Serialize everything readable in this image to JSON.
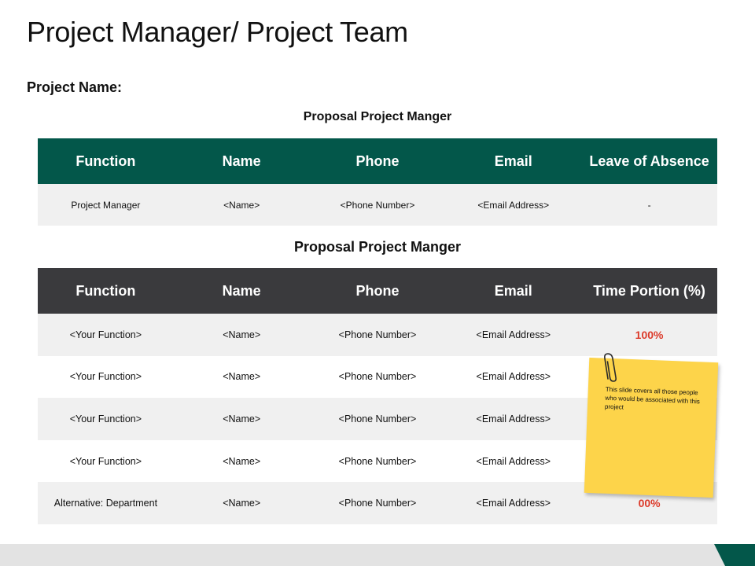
{
  "slide": {
    "title": "Project Manager/ Project Team",
    "project_name_label": "Project Name:"
  },
  "section1": {
    "title": "Proposal Project Manger",
    "headers": [
      "Function",
      "Name",
      "Phone",
      "Email",
      "Leave of Absence"
    ],
    "rows": [
      [
        "Project Manager",
        "<Name>",
        "<Phone Number>",
        "<Email Address>",
        "-"
      ]
    ]
  },
  "section2": {
    "title": "Proposal Project Manger",
    "headers": [
      "Function",
      "Name",
      "Phone",
      "Email",
      "Time Portion (%)"
    ],
    "rows": [
      [
        "<Your Function>",
        "<Name>",
        "<Phone Number>",
        "<Email Address>",
        "100%"
      ],
      [
        "<Your Function>",
        "<Name>",
        "<Phone Number>",
        "<Email Address>",
        ""
      ],
      [
        "<Your Function>",
        "<Name>",
        "<Phone Number>",
        "<Email Address>",
        ""
      ],
      [
        "<Your Function>",
        "<Name>",
        "<Phone Number>",
        "<Email Address>",
        ""
      ],
      [
        "Alternative:  Department",
        "<Name>",
        "<Phone Number>",
        "<Email Address>",
        "00%"
      ]
    ]
  },
  "sticky_note": {
    "text": "This slide covers all those people who would be associated with this project"
  },
  "colors": {
    "header_green": "#03574a",
    "header_dark": "#3a3a3d",
    "percent_red": "#dc3b2b",
    "note_yellow": "#fdd44a"
  }
}
